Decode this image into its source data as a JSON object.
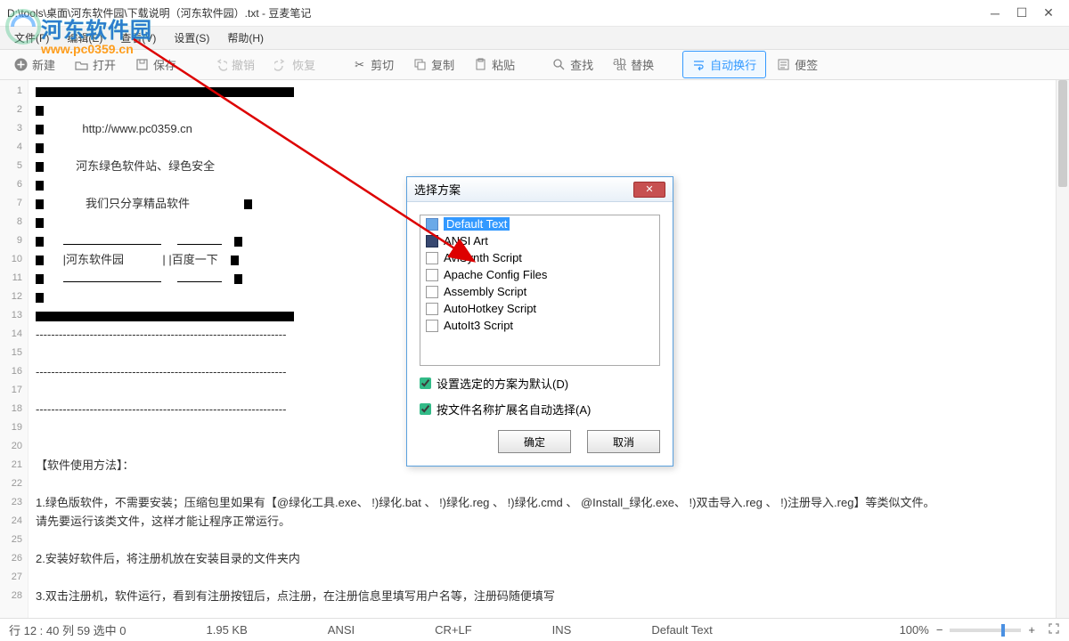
{
  "window": {
    "title": "D:\\tools\\桌面\\河东软件园\\下载说明（河东软件园）.txt - 豆麦笔记"
  },
  "watermark": {
    "name": "河东软件园",
    "url": "www.pc0359.cn"
  },
  "menu": {
    "file": "文件(F)",
    "edit": "编辑(E)",
    "view": "查看(V)",
    "settings": "设置(S)",
    "help": "帮助(H)"
  },
  "toolbar": {
    "new": "新建",
    "open": "打开",
    "save": "保存",
    "undo": "撤销",
    "redo": "恢复",
    "cut": "剪切",
    "copy": "复制",
    "paste": "粘贴",
    "find": "查找",
    "replace": "替换",
    "wrap": "自动换行",
    "sticky": "便签"
  },
  "lines": {
    "l3": "http://www.pc0359.cn",
    "l5": "河东绿色软件站、绿色安全",
    "l7": "我们只分享精品软件",
    "l10a": "|河东软件园",
    "l10b": "| |百度一下",
    "l21": "【软件使用方法】：",
    "l23": "1.绿色版软件，不需要安装；压缩包里如果有【@绿化工具.exe、 !)绿化.bat 、 !)绿化.reg 、 !)绿化.cmd 、 @Install_绿化.exe、 !)双击导入.reg 、 !)注册导入.reg】等类似文件。",
    "l24": "  请先要运行该类文件，这样才能让程序正常运行。",
    "l26": "2.安装好软件后，将注册机放在安装目录的文件夹内",
    "l28": "3.双击注册机，软件运行，看到有注册按钮后，点注册，在注册信息里填写用户名等，注册码随便填写"
  },
  "dialog": {
    "title": "选择方案",
    "items": [
      "Default Text",
      "ANSI Art",
      "AviSynth Script",
      "Apache Config Files",
      "Assembly Script",
      "AutoHotkey Script",
      "AutoIt3 Script"
    ],
    "chk1": "设置选定的方案为默认(D)",
    "chk2": "按文件名称扩展名自动选择(A)",
    "ok": "确定",
    "cancel": "取消"
  },
  "status": {
    "pos": "行 12 : 40   列 59   选中 0",
    "size": "1.95 KB",
    "enc": "ANSI",
    "eol": "CR+LF",
    "ins": "INS",
    "scheme": "Default Text",
    "zoom": "100%"
  }
}
